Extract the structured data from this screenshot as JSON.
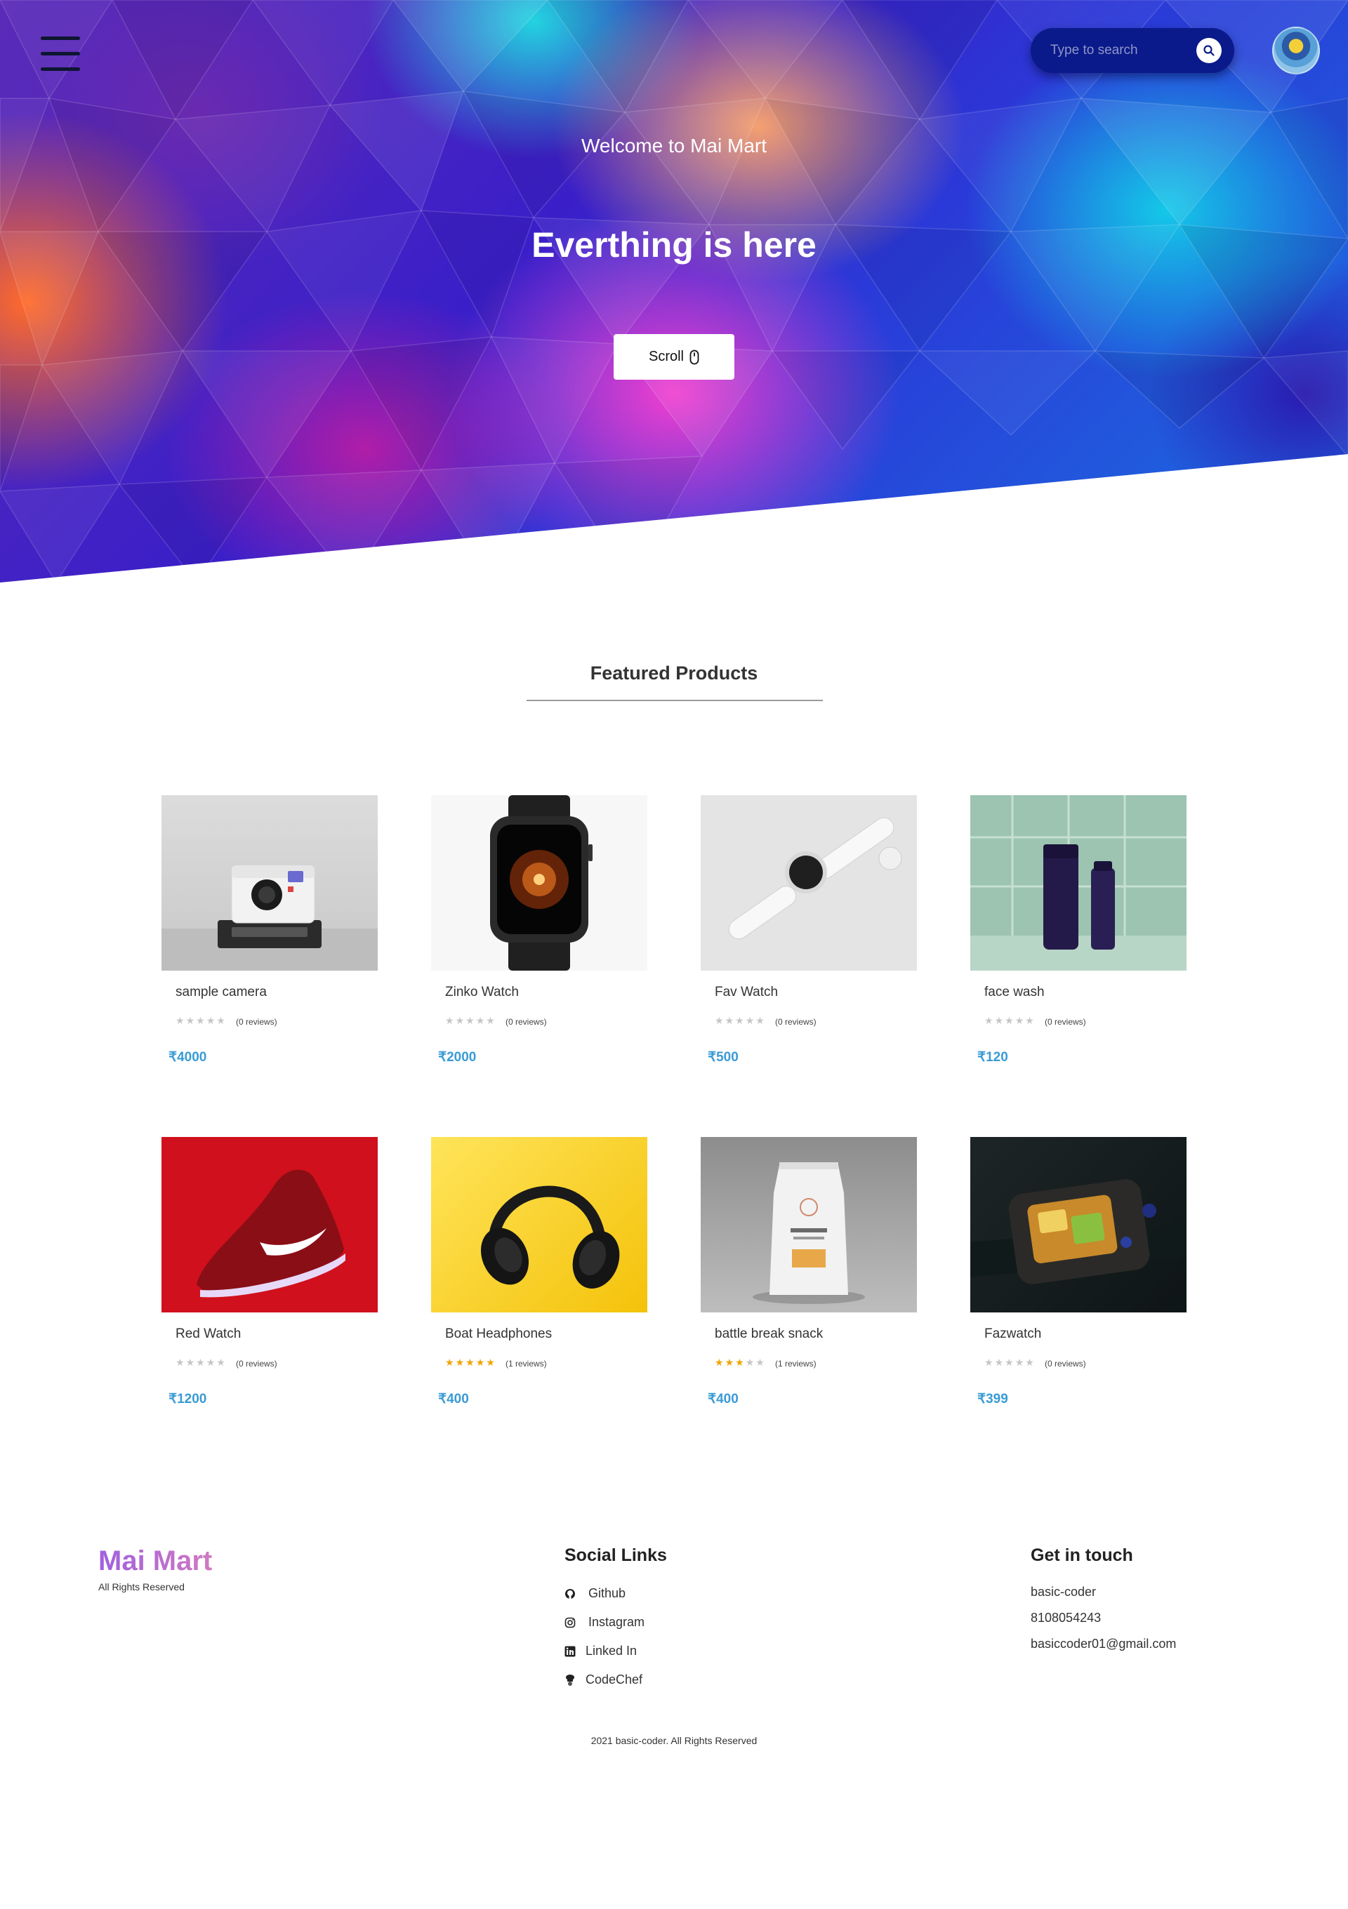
{
  "header": {
    "menu_icon": "hamburger-menu-icon",
    "search": {
      "placeholder": "Type to search",
      "icon": "search-icon"
    },
    "avatar_icon": "user-avatar"
  },
  "hero": {
    "welcome": "Welcome to Mai Mart",
    "title": "Everthing is here",
    "scroll_label": "Scroll",
    "scroll_icon": "mouse-icon"
  },
  "featured": {
    "title": "Featured Products",
    "products": [
      {
        "name": "sample camera",
        "rating": 0,
        "reviews": "(0 reviews)",
        "price": "₹4000",
        "image": "camera-image"
      },
      {
        "name": "Zinko Watch",
        "rating": 0,
        "reviews": "(0 reviews)",
        "price": "₹2000",
        "image": "smartwatch-image"
      },
      {
        "name": "Fav Watch",
        "rating": 0,
        "reviews": "(0 reviews)",
        "price": "₹500",
        "image": "white-watch-image"
      },
      {
        "name": "face wash",
        "rating": 0,
        "reviews": "(0 reviews)",
        "price": "₹120",
        "image": "face-wash-image"
      },
      {
        "name": "Red Watch",
        "rating": 0,
        "reviews": "(0 reviews)",
        "price": "₹1200",
        "image": "red-shoe-image"
      },
      {
        "name": "Boat Headphones",
        "rating": 5,
        "reviews": "(1 reviews)",
        "price": "₹400",
        "image": "headphones-image"
      },
      {
        "name": "battle break snack",
        "rating": 3,
        "reviews": "(1 reviews)",
        "price": "₹400",
        "image": "coffee-bag-image"
      },
      {
        "name": "Fazwatch",
        "rating": 0,
        "reviews": "(0 reviews)",
        "price": "₹399",
        "image": "dark-watch-image"
      }
    ],
    "star_color": "#f0a500",
    "price_color": "#3a9bd6"
  },
  "footer": {
    "brand": "Mai Mart",
    "brand_sub": "All Rights Reserved",
    "social_title": "Social Links",
    "social_links": [
      {
        "label": "Github",
        "icon": "github-icon"
      },
      {
        "label": "Instagram",
        "icon": "instagram-icon"
      },
      {
        "label": "Linked In",
        "icon": "linkedin-icon"
      },
      {
        "label": "CodeChef",
        "icon": "codechef-icon"
      }
    ],
    "contact_title": "Get in touch",
    "contact": [
      "basic-coder",
      "8108054243",
      "basiccoder01@gmail.com"
    ],
    "copyright": "2021 basic-coder. All Rights Reserved"
  }
}
